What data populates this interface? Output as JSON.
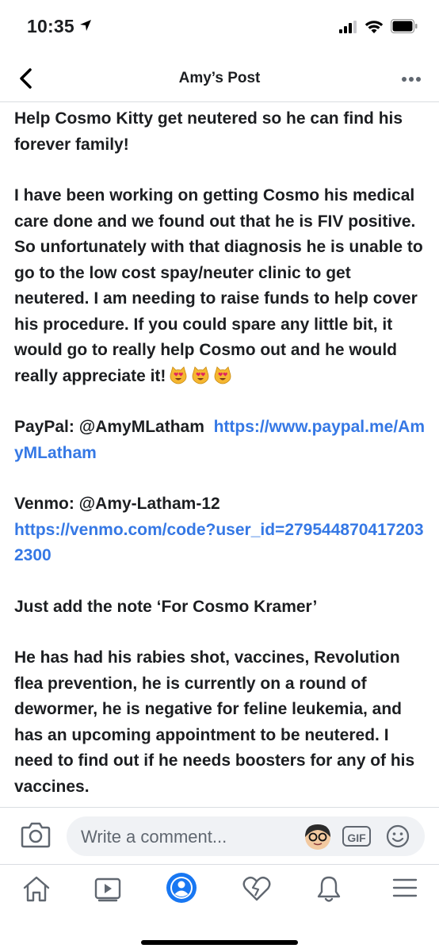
{
  "status_bar": {
    "time": "10:35"
  },
  "nav": {
    "title": "Amy’s Post"
  },
  "post": {
    "p1": "Help Cosmo Kitty get neutered so he can find his forever family!",
    "p2": "I have been working on getting Cosmo his medical care done and we found out that he is FIV positive. So unfortunately with that diagnosis he is unable to go to the low cost spay/neuter clinic to get neutered.  I am needing to raise funds to help cover his procedure. If you could spare any little bit, it would go to really help Cosmo out and he would really appreciate it!",
    "paypal_label": "PayPal: @AmyMLatham",
    "paypal_link": "https://www.paypal.me/AmyMLatham",
    "venmo_label": "Venmo: @Amy-Latham-12",
    "venmo_link": "https://venmo.com/code?user_id=2795448704172032300",
    "note": "Just add the note  ‘For Cosmo Kramer’",
    "p_last": "He has had his rabies shot, vaccines, Revolution flea prevention, he is currently on a round of dewormer, he is negative for feline leukemia, and has an upcoming appointment to be neutered. I need to find out if he needs boosters for any of his vaccines."
  },
  "comment_bar": {
    "placeholder": "Write a comment...",
    "gif_label": "GIF"
  },
  "tabs": [
    "home-icon",
    "watch-icon",
    "profile-icon",
    "dating-heart-icon",
    "notifications-bell-icon",
    "menu-icon"
  ],
  "colors": {
    "link": "#3578e5",
    "active_tab": "#1877f2",
    "inactive_icon": "#606770",
    "divider": "#dadde1"
  }
}
